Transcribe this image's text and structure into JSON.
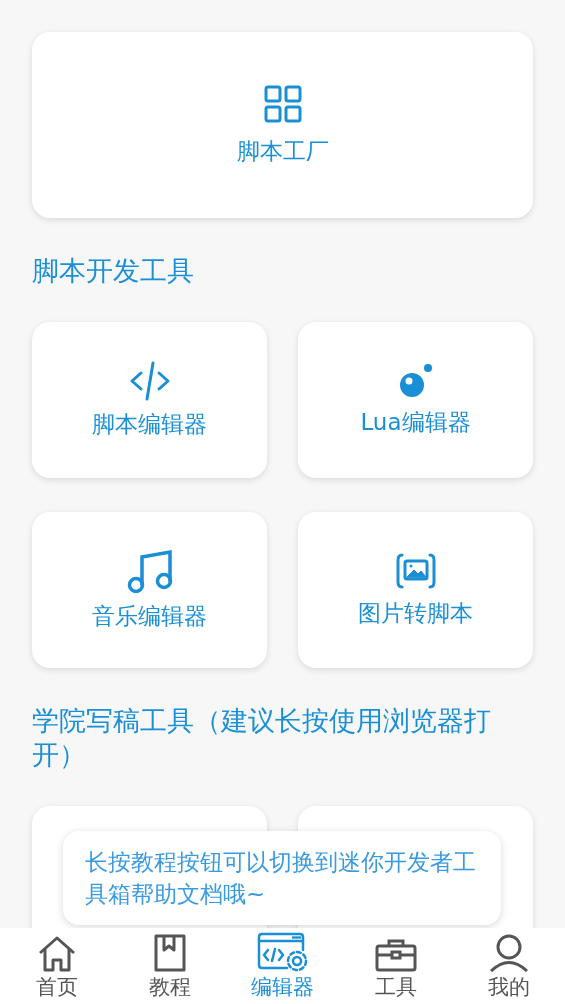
{
  "factory": {
    "label": "脚本工厂"
  },
  "sections": [
    {
      "title": "脚本开发工具",
      "cards": [
        {
          "kind": "code",
          "label": "脚本编辑器"
        },
        {
          "kind": "lua",
          "label": "Lua编辑器"
        },
        {
          "kind": "music",
          "label": "音乐编辑器"
        },
        {
          "kind": "image",
          "label": "图片转脚本"
        }
      ]
    },
    {
      "title": "学院写稿工具（建议长按使用浏览器打开）",
      "cards": [
        {
          "kind": "blank"
        },
        {
          "kind": "blank"
        }
      ]
    }
  ],
  "toast": {
    "text": "长按教程按钮可以切换到迷你开发者工具箱帮助文档哦~"
  },
  "nav": [
    {
      "kind": "home",
      "label": "首页",
      "selected": false
    },
    {
      "kind": "book",
      "label": "教程",
      "selected": false
    },
    {
      "kind": "editor",
      "label": "编辑器",
      "selected": true
    },
    {
      "kind": "toolbox",
      "label": "工具",
      "selected": false
    },
    {
      "kind": "person",
      "label": "我的",
      "selected": false
    }
  ]
}
